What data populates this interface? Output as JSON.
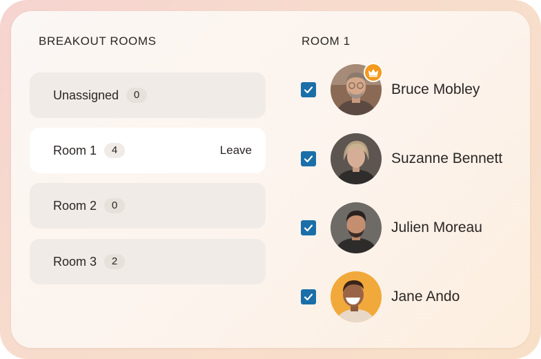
{
  "breakout_rooms": {
    "title": "BREAKOUT ROOMS",
    "rooms": [
      {
        "name": "Unassigned",
        "count": "0",
        "active": false
      },
      {
        "name": "Room 1",
        "count": "4",
        "active": true,
        "action": "Leave"
      },
      {
        "name": "Room 2",
        "count": "0",
        "active": false
      },
      {
        "name": "Room 3",
        "count": "2",
        "active": false
      }
    ]
  },
  "room_members": {
    "title": "ROOM 1",
    "members": [
      {
        "name": "Bruce Mobley",
        "checked": true,
        "host": true,
        "avatar_icon": "person-avatar-icon"
      },
      {
        "name": "Suzanne Bennett",
        "checked": true,
        "host": false,
        "avatar_icon": "person-avatar-icon"
      },
      {
        "name": "Julien Moreau",
        "checked": true,
        "host": false,
        "avatar_icon": "person-avatar-icon"
      },
      {
        "name": "Jane Ando",
        "checked": true,
        "host": false,
        "avatar_icon": "person-avatar-icon"
      }
    ]
  },
  "colors": {
    "checkbox": "#1a6fa8",
    "host_badge": "#f39a1f",
    "active_room_bg": "#ffffff",
    "room_bg": "#f0ebe7"
  }
}
